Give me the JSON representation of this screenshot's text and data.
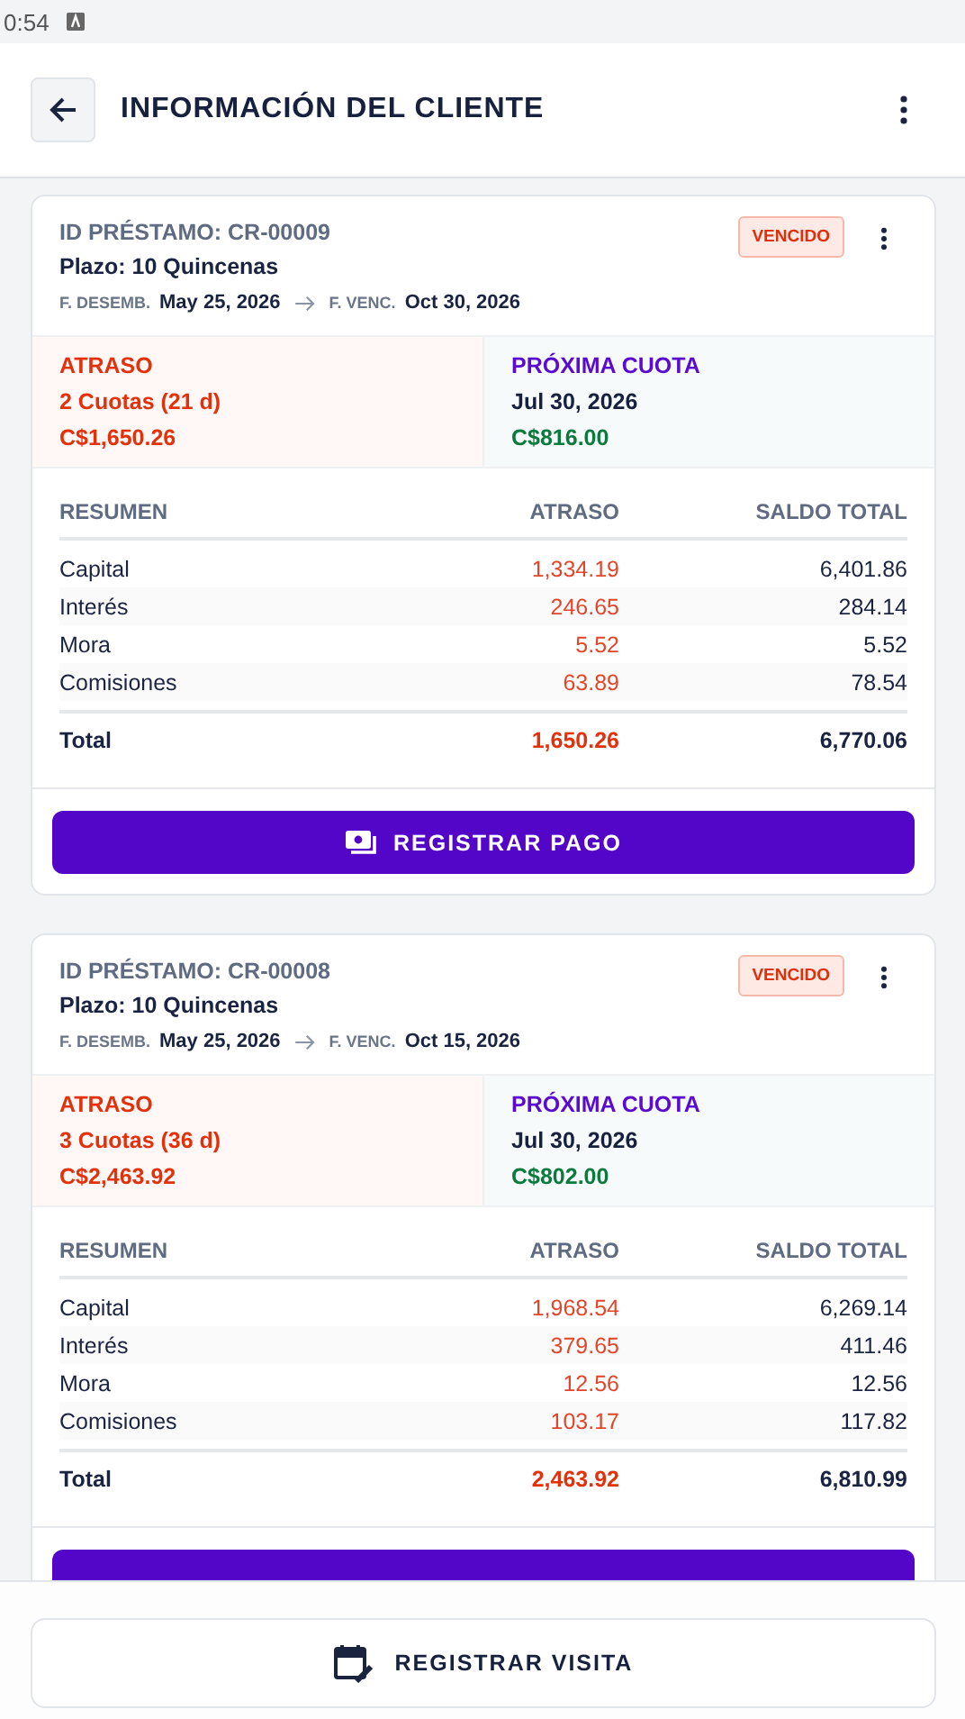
{
  "status_bar": {
    "time": "0:54"
  },
  "header": {
    "title": "INFORMACIÓN DEL CLIENTE"
  },
  "loans": [
    {
      "id": "ID PRÉSTAMO: CR-00009",
      "term": "Plazo: 10 Quincenas",
      "disb_label": "F. DESEMB.",
      "disb_date": "May 25, 2026",
      "due_label": "F. VENC.",
      "due_date": "Oct 30, 2026",
      "status": "VENCIDO",
      "overdue": {
        "label": "ATRASO",
        "count": "2 Cuotas (21 d)",
        "amount": "C$1,650.26"
      },
      "next": {
        "label": "PRÓXIMA CUOTA",
        "date": "Jul 30, 2026",
        "amount": "C$816.00"
      },
      "columns": [
        "RESUMEN",
        "ATRASO",
        "SALDO TOTAL"
      ],
      "rows": [
        {
          "label": "Capital",
          "overdue": "1,334.19",
          "balance": "6,401.86"
        },
        {
          "label": "Interés",
          "overdue": "246.65",
          "balance": "284.14"
        },
        {
          "label": "Mora",
          "overdue": "5.52",
          "balance": "5.52"
        },
        {
          "label": "Comisiones",
          "overdue": "63.89",
          "balance": "78.54"
        }
      ],
      "total": {
        "label": "Total",
        "overdue": "1,650.26",
        "balance": "6,770.06"
      },
      "button": "REGISTRAR PAGO"
    },
    {
      "id": "ID PRÉSTAMO: CR-00008",
      "term": "Plazo: 10 Quincenas",
      "disb_label": "F. DESEMB.",
      "disb_date": "May 25, 2026",
      "due_label": "F. VENC.",
      "due_date": "Oct 15, 2026",
      "status": "VENCIDO",
      "overdue": {
        "label": "ATRASO",
        "count": "3 Cuotas (36 d)",
        "amount": "C$2,463.92"
      },
      "next": {
        "label": "PRÓXIMA CUOTA",
        "date": "Jul 30, 2026",
        "amount": "C$802.00"
      },
      "columns": [
        "RESUMEN",
        "ATRASO",
        "SALDO TOTAL"
      ],
      "rows": [
        {
          "label": "Capital",
          "overdue": "1,968.54",
          "balance": "6,269.14"
        },
        {
          "label": "Interés",
          "overdue": "379.65",
          "balance": "411.46"
        },
        {
          "label": "Mora",
          "overdue": "12.56",
          "balance": "12.56"
        },
        {
          "label": "Comisiones",
          "overdue": "103.17",
          "balance": "117.82"
        }
      ],
      "total": {
        "label": "Total",
        "overdue": "2,463.92",
        "balance": "6,810.99"
      }
    }
  ],
  "footer": {
    "button": "REGISTRAR VISITA"
  }
}
